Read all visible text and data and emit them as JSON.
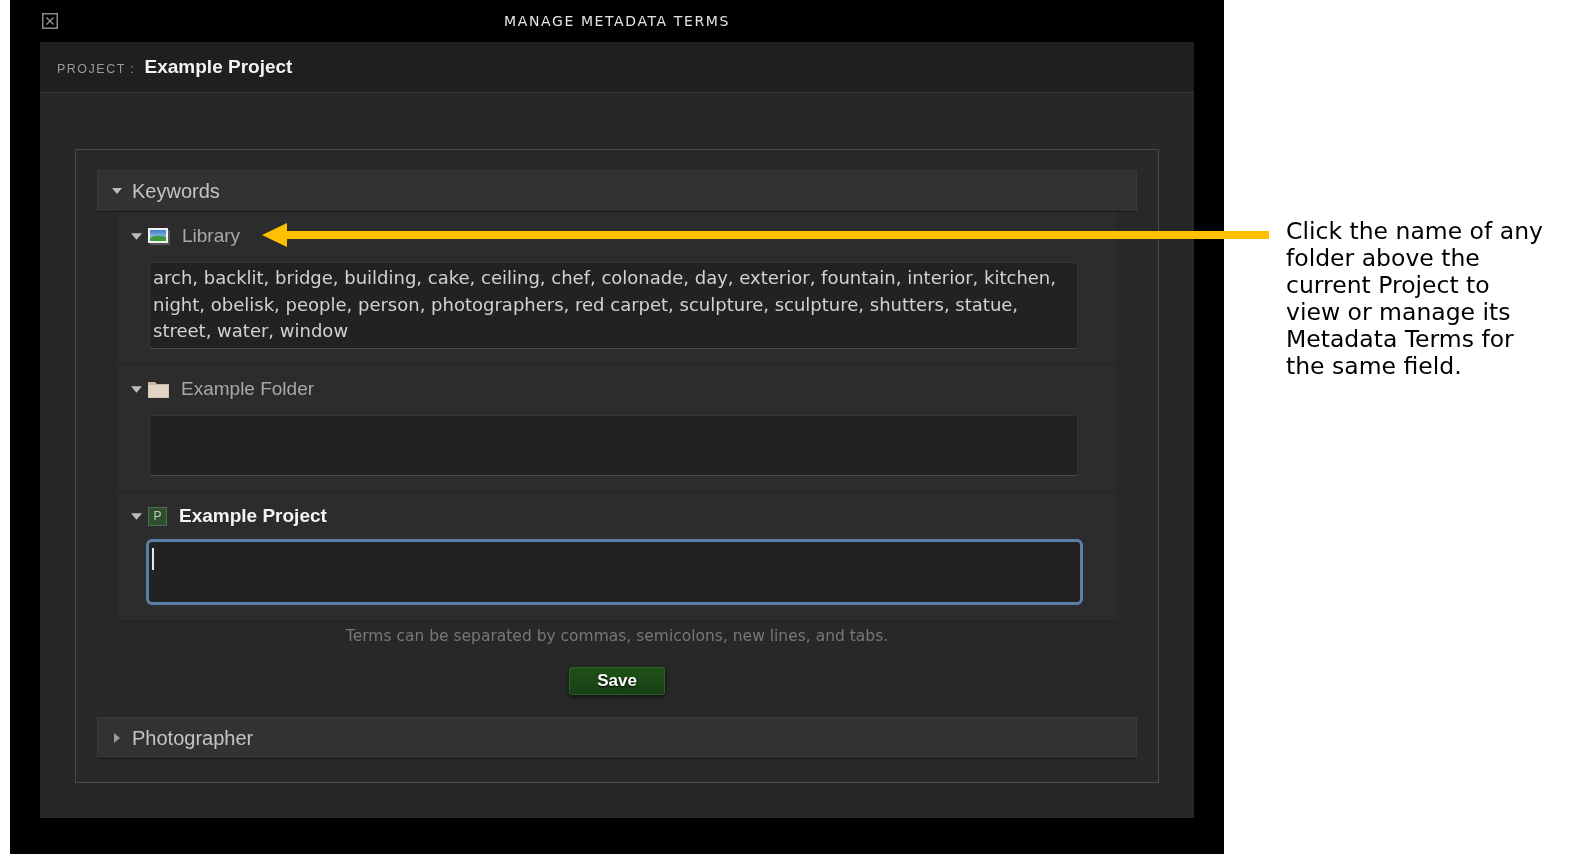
{
  "window": {
    "title": "MANAGE METADATA TERMS"
  },
  "project": {
    "label": "PROJECT :",
    "name": "Example Project"
  },
  "sections": [
    {
      "title": "Keywords",
      "expanded": true,
      "folders": [
        {
          "kind": "library",
          "name": "Library",
          "expanded": true,
          "focused": false,
          "terms": "arch, backlit, bridge, building, cake, ceiling, chef, colonade, day, exterior, fountain, interior, kitchen, night, obelisk, people, person, photographers, red carpet, sculpture, sculpture, shutters, statue, street, water, window"
        },
        {
          "kind": "folder",
          "name": "Example Folder",
          "expanded": true,
          "focused": false
        },
        {
          "kind": "project",
          "name": "Example Project",
          "icon_text": "P",
          "expanded": true,
          "focused": true
        }
      ],
      "hint": "Terms can be separated by commas, semicolons, new lines, and tabs.",
      "save_button": "Save"
    },
    {
      "title": "Photographer",
      "expanded": false
    }
  ],
  "annotation": {
    "text": "Click the name of any folder above the current Project to view or manage its Metadata Terms for the same field."
  }
}
